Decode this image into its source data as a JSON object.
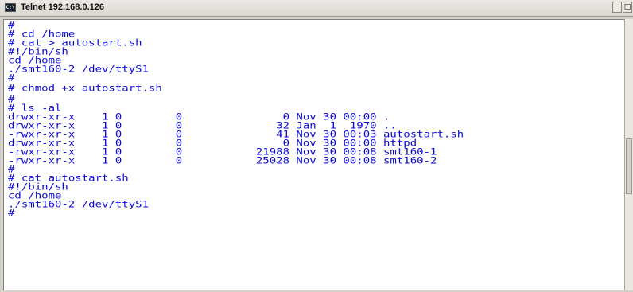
{
  "window": {
    "title": "Telnet 192.168.0.126",
    "icon": "telnet-console-icon",
    "icon_glyph": "C:\\",
    "minimize_glyph": "_",
    "maximize_glyph": "□",
    "close_glyph": "×"
  },
  "terminal": {
    "text_color": "#0a0ad8",
    "background": "#ffffff",
    "lines": [
      "#",
      "# cd /home",
      "# cat > autostart.sh",
      "#!/bin/sh",
      "cd /home",
      "./smt160-2 /dev/ttyS1",
      "#",
      "# chmod +x autostart.sh",
      "#",
      "# ls -al",
      "drwxr-xr-x    1 0        0               0 Nov 30 00:00 .",
      "drwxr-xr-x    1 0        0              32 Jan  1  1970 ..",
      "-rwxr-xr-x    1 0        0              41 Nov 30 00:03 autostart.sh",
      "drwxr-xr-x    1 0        0               0 Nov 30 00:00 httpd",
      "-rwxr-xr-x    1 0        0           21988 Nov 30 00:08 smt160-1",
      "-rwxr-xr-x    1 0        0           25028 Nov 30 00:08 smt160-2",
      "#",
      "# cat autostart.sh",
      "#!/bin/sh",
      "cd /home",
      "./smt160-2 /dev/ttyS1",
      "#"
    ]
  }
}
